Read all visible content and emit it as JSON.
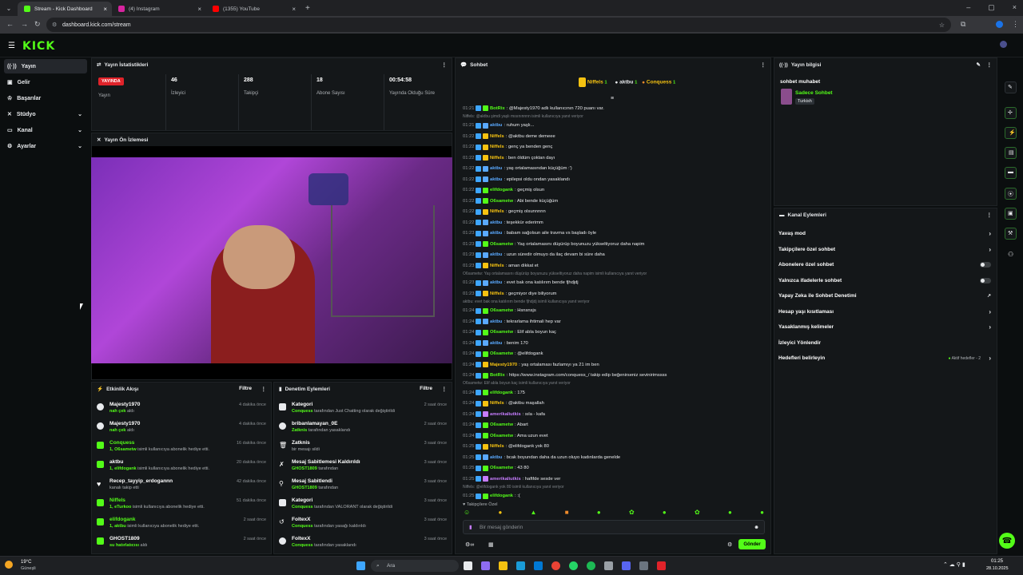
{
  "browser": {
    "tabs": [
      {
        "label": "Stream - Kick Dashboard",
        "color": "#53fc18"
      },
      {
        "label": "(4) Instagram",
        "color": "#d6249f"
      },
      {
        "label": "(1355) YouTube",
        "color": "#ff0000"
      }
    ],
    "url": "dashboard.kick.com/stream"
  },
  "app": {
    "logo": "KICK"
  },
  "sidebar": {
    "items": [
      {
        "label": "Yayın",
        "active": true,
        "icon": "broadcast-icon"
      },
      {
        "label": "Gelir",
        "icon": "wallet-icon"
      },
      {
        "label": "Başarılar",
        "icon": "trophy-icon"
      },
      {
        "label": "Stüdyo",
        "icon": "studio-icon",
        "chev": true
      },
      {
        "label": "Kanal",
        "icon": "channel-icon",
        "chev": true
      },
      {
        "label": "Ayarlar",
        "icon": "settings-icon",
        "chev": true
      }
    ]
  },
  "stats": {
    "title": "Yayın İstatistikleri",
    "live_badge": "YAYINDA",
    "live_label": "Yayın",
    "items": [
      {
        "value": "46",
        "label": "İzleyici"
      },
      {
        "value": "288",
        "label": "Takipçi"
      },
      {
        "value": "18",
        "label": "Abone Sayısı"
      },
      {
        "value": "00:54:58",
        "label": "Yayında Olduğu Süre"
      }
    ]
  },
  "preview": {
    "title": "Yayın Ön İzlemesi"
  },
  "activity": {
    "title": "Etkinlik Akışı",
    "filter": "Filtre",
    "rows": [
      {
        "name": "Majesty1970",
        "sub_user": "nah çek",
        "sub": "aldı",
        "time": "4 dakika önce",
        "color": "#ffffff"
      },
      {
        "name": "Majesty1970",
        "sub_user": "nah çek",
        "sub": "aldı",
        "time": "4 dakika önce",
        "color": "#ffffff"
      },
      {
        "name": "Conquess",
        "sub_user": "1, O6sametw",
        "sub": "isimli kullanıcıya abonelik hediye etti.",
        "time": "16 dakika önce",
        "color": "#53fc18"
      },
      {
        "name": "aktbu",
        "sub_user": "1, elifdogank",
        "sub": "isimli kullanıcıya abonelik hediye etti.",
        "time": "20 dakika önce",
        "color": "#53fc18"
      },
      {
        "name": "Recep_tayyip_erdogannn",
        "sub_user": "",
        "sub": "kanalı takip etti",
        "time": "42 dakika önce",
        "color": "#ffffff"
      },
      {
        "name": "Niffels",
        "sub_user": "1, eTurkoo",
        "sub": "isimli kullanıcıya abonelik hediye etti.",
        "time": "51 dakika önce",
        "color": "#53fc18"
      },
      {
        "name": "elifdogank",
        "sub_user": "1, aktbu",
        "sub": "isimli kullanıcıya abonelik hediye etti.",
        "time": "2 saat önce",
        "color": "#53fc18"
      },
      {
        "name": "GHOST1809",
        "sub_user": "su hatırlatıcısı",
        "sub": "aldı",
        "time": "2 saat önce",
        "color": "#53fc18"
      }
    ]
  },
  "moderation": {
    "title": "Denetim Eylemleri",
    "filter": "Filtre",
    "rows": [
      {
        "name": "Kategori",
        "sub_user": "Conquess",
        "sub": "tarafından Just Chatting olarak değiştirildi",
        "time": "2 saat önce"
      },
      {
        "name": "bribanlamayan_0E",
        "sub_user": "Zatknis",
        "sub": "tarafından yasaklandı",
        "time": "2 saat önce"
      },
      {
        "name": "Zatknis",
        "sub_user": "",
        "sub": "bir mesajı sildi",
        "time": "3 saat önce"
      },
      {
        "name": "Mesaj Sabitlemesi Kaldırıldı",
        "sub_user": "GHOST1809",
        "sub": "tarafından",
        "time": "3 saat önce"
      },
      {
        "name": "Mesaj Sabitlendi",
        "sub_user": "GHOST1809",
        "sub": "tarafından",
        "time": "3 saat önce"
      },
      {
        "name": "Kategori",
        "sub_user": "Conquess",
        "sub": "tarafından VALORANT olarak değiştirildi",
        "time": "3 saat önce"
      },
      {
        "name": "FoltexX",
        "sub_user": "Conquess",
        "sub": "tarafından yasağı kaldırıldı",
        "time": "3 saat önce"
      },
      {
        "name": "FoltexX",
        "sub_user": "Conquess",
        "sub": "tarafından yasaklandı",
        "time": "3 saat önce"
      }
    ]
  },
  "chat": {
    "title": "Sohbet",
    "top": {
      "first": "Niffels",
      "first_n": "1",
      "second": "aktbu",
      "second_n": "1",
      "third": "Conquess",
      "third_n": "1"
    },
    "lines": [
      {
        "t": "01:21",
        "u": "BotRix",
        "c": "#53fc18",
        "m": ": @Majesty1970 adlı kullanıcının 720 puanı var."
      },
      {
        "reply": "Niffels: @aktbu şimdi yaşlı mısınınnnn isimli kullanıcıya yanıt veriyor"
      },
      {
        "t": "01:21",
        "u": "aktbu",
        "c": "#5aa9ff",
        "m": ": ruhum yaşlı..."
      },
      {
        "t": "01:22",
        "u": "Niffels",
        "c": "#f5c211",
        "m": ": @aktbu deme demeee"
      },
      {
        "t": "01:22",
        "u": "Niffels",
        "c": "#f5c211",
        "m": ": genç ya benden genç"
      },
      {
        "t": "01:22",
        "u": "Niffels",
        "c": "#f5c211",
        "m": ": ben öldüm çoktan dayı"
      },
      {
        "t": "01:22",
        "u": "aktbu",
        "c": "#5aa9ff",
        "m": ": yaş ortalamasından küçüğüm :')"
      },
      {
        "t": "01:22",
        "u": "aktbu",
        "c": "#5aa9ff",
        "m": ": epilepsi oldu ondan yasaklandı"
      },
      {
        "t": "01:22",
        "u": "elifdogank",
        "c": "#53fc18",
        "m": ": geçmiş olsun"
      },
      {
        "t": "01:22",
        "u": "O6sametw",
        "c": "#53fc18",
        "m": ": Abi bende küçüğüm"
      },
      {
        "t": "01:22",
        "u": "Niffels",
        "c": "#f5c211",
        "m": ": geçmiş olsunnnnn"
      },
      {
        "t": "01:22",
        "u": "aktbu",
        "c": "#5aa9ff",
        "m": ": teşekkür ederimm"
      },
      {
        "t": "01:23",
        "u": "aktbu",
        "c": "#5aa9ff",
        "m": ": babam sağolsun aile travma vs başladı öyle"
      },
      {
        "t": "01:23",
        "u": "O6sametw",
        "c": "#53fc18",
        "m": ": Yaş ortalamasını düşürüp boyunuzu yükseltiyoruz daha napim"
      },
      {
        "t": "01:23",
        "u": "aktbu",
        "c": "#5aa9ff",
        "m": ": uzun süredir olmuyo da ilaç devam bi süre daha"
      },
      {
        "t": "01:23",
        "u": "Niffels",
        "c": "#f5c211",
        "m": ": aman dikkat et"
      },
      {
        "reply": "O6sametw: Yaş ortalamasını düşürüp boyunuzu yükseltiyoruz daha napim isimli kullanıcıya yanıt veriyor"
      },
      {
        "t": "01:23",
        "u": "aktbu",
        "c": "#5aa9ff",
        "m": ": evet bak ona katılırım bende fjhdjdj"
      },
      {
        "t": "01:23",
        "u": "Niffels",
        "c": "#f5c211",
        "m": ": geçmiyor diye biliyorum"
      },
      {
        "reply": "aktbu: evet bak ona katılırım bende fjhdjdj isimli kullanıcıya yanıt veriyor"
      },
      {
        "t": "01:24",
        "u": "O6sametw",
        "c": "#53fc18",
        "m": ": Hsnsnsjs"
      },
      {
        "t": "01:24",
        "u": "aktbu",
        "c": "#5aa9ff",
        "m": ": tekrarlama ihtimali hep var"
      },
      {
        "t": "01:24",
        "u": "O6sametw",
        "c": "#53fc18",
        "m": ": Elif abla boyun kaç"
      },
      {
        "t": "01:24",
        "u": "aktbu",
        "c": "#5aa9ff",
        "m": ": benim 170"
      },
      {
        "t": "01:24",
        "u": "O6sametw",
        "c": "#53fc18",
        "m": ": @elifdogank"
      },
      {
        "t": "01:24",
        "u": "Majesty1970",
        "c": "#f5c211",
        "m": ": yaş ortalaması fazlamıyı ya 21 im ben"
      },
      {
        "t": "01:24",
        "u": "BotRix",
        "c": "#53fc18",
        "m": ": https://www.instagram.com/conquess_/ takip edip beğenirseniz sevinirimssss"
      },
      {
        "reply": "O6sametw: Elif abla boyun kaç isimli kullanıcıya yanıt veriyor"
      },
      {
        "t": "01:24",
        "u": "elifdogank",
        "c": "#53fc18",
        "m": ": 175"
      },
      {
        "t": "01:24",
        "u": "Niffels",
        "c": "#f5c211",
        "m": ": @aktbu maşallah"
      },
      {
        "t": "01:24",
        "u": "amerikaliutkis",
        "c": "#c77dff",
        "m": ": sıla - kafa"
      },
      {
        "t": "01:24",
        "u": "O6sametw",
        "c": "#53fc18",
        "m": ": Abart"
      },
      {
        "t": "01:24",
        "u": "O6sametw",
        "c": "#53fc18",
        "m": ": Ama uzun evet"
      },
      {
        "t": "01:25",
        "u": "Niffels",
        "c": "#f5c211",
        "m": ": @elifdogank yok 80"
      },
      {
        "t": "01:25",
        "u": "aktbu",
        "c": "#5aa9ff",
        "m": ": bcak boyundan daha da uzun oluyo kadınlarda genelde"
      },
      {
        "t": "01:25",
        "u": "O6sametw",
        "c": "#53fc18",
        "m": ": 43 80"
      },
      {
        "t": "01:25",
        "u": "amerikaliutkis",
        "c": "#c77dff",
        "m": ": haftfde sesde ver"
      },
      {
        "reply": "Niffels: @elifdogank yok 80 isimli kullanıcıya yanıt veriyor"
      },
      {
        "t": "01:25",
        "u": "elifdogank",
        "c": "#53fc18",
        "m": ": :("
      }
    ],
    "followers_only": "Takipçilere Özel",
    "input_placeholder": "Bir mesaj gönderin",
    "send": "Gönder"
  },
  "info": {
    "title": "Yayın bilgisi",
    "stream_title": "sohbet muhabet",
    "category": "Sadece Sohbet",
    "language": "Turkish"
  },
  "channel_actions": {
    "title": "Kanal Eylemleri",
    "rows": [
      {
        "label": "Yavaş mod",
        "kind": "chev"
      },
      {
        "label": "Takipçilere özel sohbet",
        "kind": "chev"
      },
      {
        "label": "Abonelere özel sohbet",
        "kind": "toggle"
      },
      {
        "label": "Yalnızca ifadelerle sohbet",
        "kind": "toggle"
      },
      {
        "label": "Yapay Zeka ile Sohbet Denetimi",
        "kind": "ext"
      },
      {
        "label": "Hesap yaşı kısıtlaması",
        "kind": "chev"
      },
      {
        "label": "Yasaklanmış kelimeler",
        "kind": "chev"
      },
      {
        "label": "İzleyici Yönlendir",
        "kind": "none"
      },
      {
        "label": "Hedefleri belirleyin",
        "kind": "goal",
        "extra": "Aktif hedefler - 2"
      }
    ]
  },
  "taskbar": {
    "weather_temp": "19°C",
    "weather_desc": "Güneşli",
    "search": "Ara",
    "time": "01:25",
    "date": "28.10.2025"
  }
}
